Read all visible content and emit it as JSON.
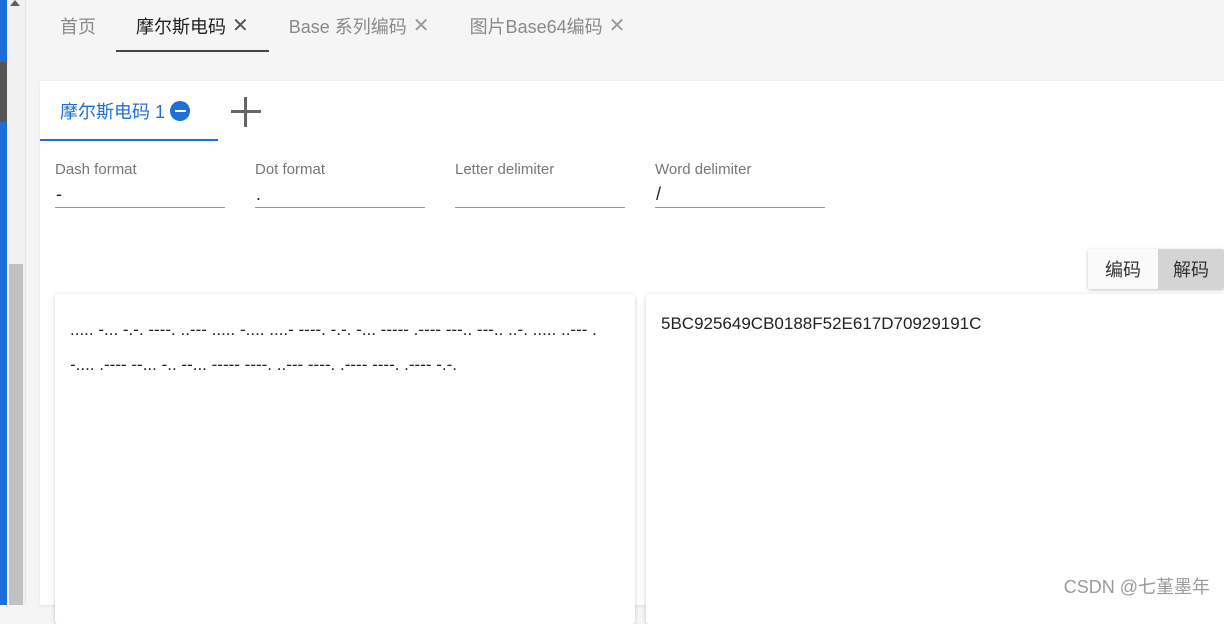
{
  "top_tabs": [
    {
      "label": "首页",
      "closable": false
    },
    {
      "label": "摩尔斯电码",
      "closable": true,
      "active": true
    },
    {
      "label": "Base 系列编码",
      "closable": true
    },
    {
      "label": "图片Base64编码",
      "closable": true
    }
  ],
  "close_glyph": "✕",
  "inner_tab": {
    "label": "摩尔斯电码 1"
  },
  "fields": {
    "dash": {
      "label": "Dash format",
      "value": "-"
    },
    "dot": {
      "label": "Dot format",
      "value": "."
    },
    "letter": {
      "label": "Letter delimiter",
      "value": ""
    },
    "word": {
      "label": "Word delimiter",
      "value": "/"
    }
  },
  "mode": {
    "encode": "编码",
    "decode": "解码",
    "selected": "decode"
  },
  "input_text": "..... -... -.-. ----. ..--- ..... -.... ....- ----. -.-. -... ----- .---- ---.. ---.. ..-. ..... ..--- . -.... .---- --... -.. --... ----- ----. ..--- ----. .---- ----. .---- -.-.",
  "output_text": "5BC925649CB0188F52E617D70929191C",
  "watermark": "CSDN @七堇墨年",
  "colors": {
    "accent": "#1e6fd9"
  }
}
